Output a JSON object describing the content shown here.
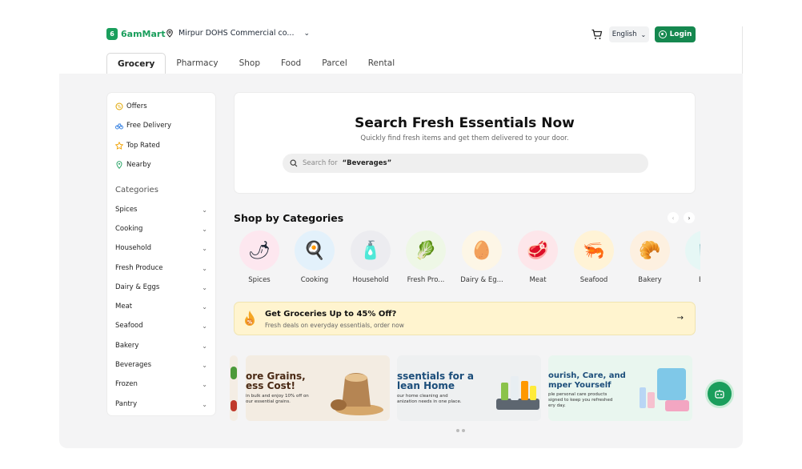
{
  "brand": {
    "name": "6amMart",
    "color": "#1a9e5c"
  },
  "header": {
    "location": "Mirpur DOHS Commercial co...",
    "language": "English",
    "login_label": "Login"
  },
  "tabs": [
    "Grocery",
    "Pharmacy",
    "Shop",
    "Food",
    "Parcel",
    "Rental"
  ],
  "sidebar": {
    "quick_links": [
      "Offers",
      "Free Delivery",
      "Top Rated",
      "Nearby"
    ],
    "categories_title": "Categories",
    "categories": [
      "Spices",
      "Cooking",
      "Household",
      "Fresh Produce",
      "Dairy & Eggs",
      "Meat",
      "Seafood",
      "Bakery",
      "Beverages",
      "Frozen",
      "Pantry"
    ]
  },
  "search": {
    "title": "Search Fresh Essentials Now",
    "subtitle": "Quickly find fresh items and get them delivered to your door.",
    "placeholder_prefix": "Search for",
    "placeholder_term": "“Beverages”"
  },
  "shop_by_categories": {
    "title": "Shop by Categories",
    "items": [
      "Spices",
      "Cooking",
      "Household",
      "Fresh Pro...",
      "Dairy & Eg...",
      "Meat",
      "Seafood",
      "Bakery",
      "Bev"
    ]
  },
  "promo": {
    "title": "Get Groceries Up to 45% Off?",
    "subtitle": "Fresh deals on everyday essentials, order now"
  },
  "banners": [
    {
      "headline1": "ore Grains,",
      "headline2": "ess Cost!",
      "sub1": "in bulk and enjoy 10% off on",
      "sub2": "our essential grains."
    },
    {
      "headline1": "ssentials for a",
      "headline2": "lean Home",
      "sub1": "our home cleaning and",
      "sub2": "anization needs in one place."
    },
    {
      "headline1": "ourish, Care, and",
      "headline2": "mper Yourself",
      "sub1": "ple personal care products",
      "sub2": "signed to keep you refreshed",
      "sub3": "ery day."
    }
  ]
}
